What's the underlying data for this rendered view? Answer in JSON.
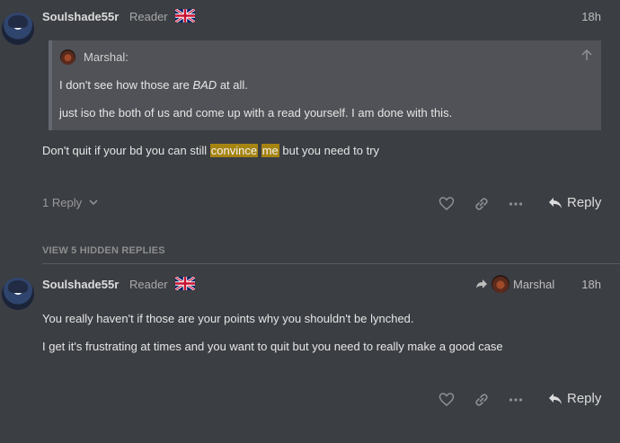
{
  "post1": {
    "username": "Soulshade55r",
    "user_title": "Reader",
    "time": "18h",
    "quote": {
      "username": "Marshal:",
      "line1_pre": "I don't see how those are ",
      "line1_em": "BAD",
      "line1_post": " at all.",
      "line2": "just iso the both of us and come up with a read yourself. I am done with this."
    },
    "body_pre": "Don't quit if your bd you can still ",
    "highlight1": "convince",
    "highlight2": "me",
    "body_post": " but you need to try",
    "replies_toggle": "1 Reply",
    "reply_label": "Reply"
  },
  "hidden_replies": "VIEW 5 HIDDEN REPLIES",
  "post2": {
    "username": "Soulshade55r",
    "user_title": "Reader",
    "reply_to": "Marshal",
    "time": "18h",
    "line1": "You really haven't if those are your points why you shouldn't be lynched.",
    "line2": "I get it's frustrating at times and you want to quit but you need to really make a good case",
    "reply_label": "Reply"
  },
  "colors": {
    "highlight": "#a68412",
    "background": "#3b3e43",
    "quote_bg": "#505257"
  },
  "icons": [
    "uk-flag-icon",
    "chevron-down-icon",
    "heart-icon",
    "link-icon",
    "more-icon",
    "reply-arrow-icon",
    "arrow-up-icon",
    "share-arrow-icon"
  ]
}
